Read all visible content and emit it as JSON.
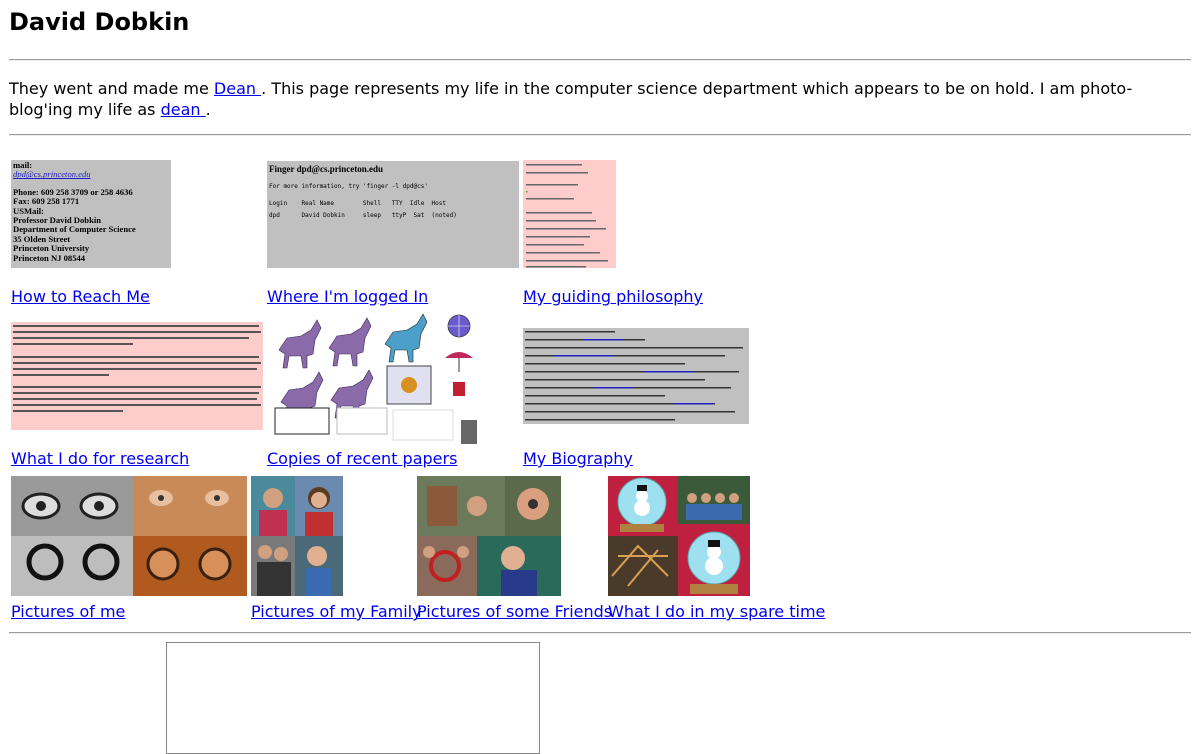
{
  "page": {
    "title": "David Dobkin"
  },
  "intro": {
    "before": "They went and made me ",
    "link1": "Dean ",
    "middle": ". This page represents my life in the computer science department which appears to be on hold. I am photo-blog'ing my life as ",
    "link2": "dean ",
    "after": "."
  },
  "contact_card": {
    "lines": [
      "mail:",
      "dpd@cs.princeton.edu",
      "Phone: 609 258 3709 or 258 4636",
      "Fax: 609 258 1771",
      "USMail:",
      "Professor David Dobkin",
      "Department of Computer Science",
      "35 Olden Street",
      "Princeton University",
      "Princeton NJ 08544"
    ]
  },
  "finger_card": {
    "title": "Finger dpd@cs.princeton.edu",
    "hint": "For more information, try 'finger -l dpd@cs'",
    "header": "Login    Real Name        Shell   TTY  Idle  Host",
    "row": "dpd      David Dobkin     sleep   ttyP  Sat  (noted)"
  },
  "captions": {
    "reach": "How to Reach Me",
    "logged": "Where I'm logged In",
    "philosophy": "My guiding philosophy",
    "research": "What I do for research",
    "papers": "Copies of recent papers",
    "bio": "My Biography",
    "me": "Pictures of me",
    "family": "Pictures of my Family",
    "friends": "Pictures of some Friends",
    "spare": "What I do in my spare time"
  },
  "icons": [
    "horse-icon",
    "globe-icon",
    "umbrella-icon",
    "snow-globe-icon"
  ]
}
